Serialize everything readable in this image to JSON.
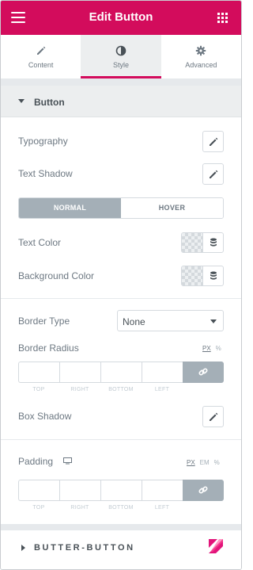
{
  "header": {
    "title": "Edit Button",
    "menu_icon": "hamburger-icon",
    "apps_icon": "grid-icon",
    "color": "#d30c5c"
  },
  "tabs": [
    {
      "label": "Content",
      "icon": "pencil-icon"
    },
    {
      "label": "Style",
      "icon": "contrast-icon",
      "active": true
    },
    {
      "label": "Advanced",
      "icon": "gear-icon"
    }
  ],
  "section": {
    "title": "Button"
  },
  "controls": {
    "typography": "Typography",
    "text_shadow": "Text Shadow",
    "state_tabs": {
      "normal": "NORMAL",
      "hover": "HOVER"
    },
    "text_color": "Text Color",
    "background_color": "Background Color",
    "border_type": {
      "label": "Border Type",
      "value": "None"
    },
    "border_radius": {
      "label": "Border Radius",
      "units": [
        "PX",
        "%"
      ],
      "active_unit": "PX"
    },
    "box_shadow": "Box Shadow",
    "padding": {
      "label": "Padding",
      "units": [
        "PX",
        "EM",
        "%"
      ],
      "active_unit": "PX"
    },
    "dimension_labels": [
      "TOP",
      "RIGHT",
      "BOTTOM",
      "LEFT"
    ]
  },
  "footer": {
    "title": "BUTTER-BUTTON"
  }
}
